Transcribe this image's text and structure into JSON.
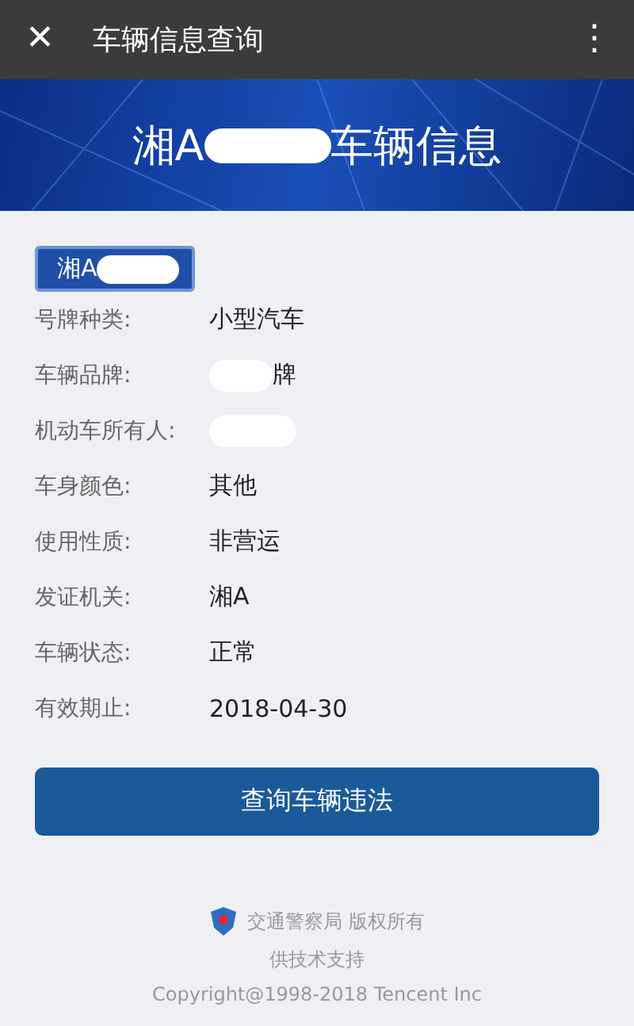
{
  "top_bar": {
    "close": "✕",
    "title": "车辆信息查询",
    "menu": "⋮"
  },
  "banner": {
    "title_prefix": "湘A",
    "title_suffix": "车辆信息"
  },
  "plate": {
    "prefix": "湘A"
  },
  "fields": [
    {
      "label": "号牌种类:",
      "value": "小型汽车",
      "redacted": false
    },
    {
      "label": "车辆品牌:",
      "value": "牌",
      "redacted": true
    },
    {
      "label": "机动车所有人:",
      "redacted": true
    },
    {
      "label": "车身颜色:",
      "value": "其他",
      "redacted": false
    },
    {
      "label": "使用性质:",
      "value": "非营运",
      "redacted": false
    },
    {
      "label": "发证机关:",
      "value": "湘A",
      "redacted": false
    },
    {
      "label": "车辆状态:",
      "value": "正常",
      "redacted": false
    },
    {
      "label": "有效期止:",
      "value": "2018-04-30",
      "redacted": false
    }
  ],
  "action_button": "查询车辆违法",
  "footer": {
    "lines": [
      "交通警察局 版权所有",
      "供技术支持"
    ],
    "copyright": "Copyright@1998-2018 Tencent Inc"
  }
}
